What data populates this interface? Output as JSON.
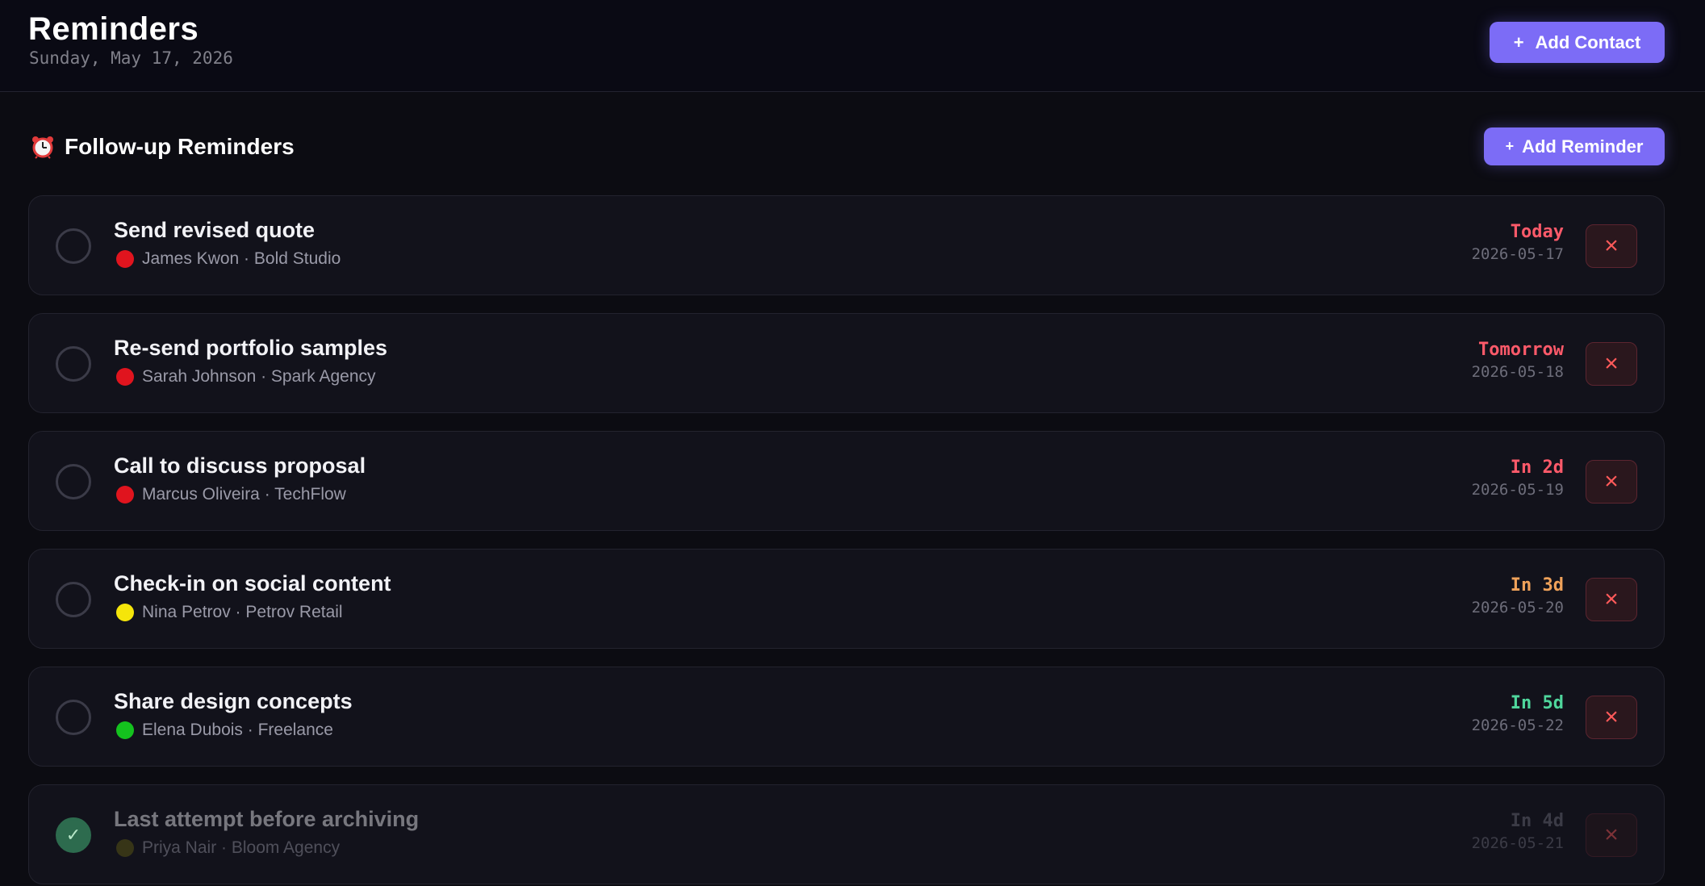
{
  "header": {
    "title": "Reminders",
    "date": "Sunday, May 17, 2026",
    "add_contact_label": "Add Contact",
    "add_contact_icon": "+"
  },
  "section": {
    "title": "Follow-up Reminders",
    "icon": "alarm-clock-icon",
    "add_reminder_label": "Add Reminder",
    "add_reminder_icon": "+"
  },
  "colors": {
    "accent": "#7c6cf6",
    "urgent": "#ff5a6a",
    "soon": "#f0a25a",
    "later": "#4fd69c"
  },
  "reminders": [
    {
      "title": "Send revised quote",
      "contact": "James Kwon · Bold Studio",
      "priority_color": "#e0141e",
      "due_label": "Today",
      "due_color": "#ff5a6a",
      "due_date": "2026-05-17",
      "done": false,
      "delete_icon": "×"
    },
    {
      "title": "Re-send portfolio samples",
      "contact": "Sarah Johnson · Spark Agency",
      "priority_color": "#e0141e",
      "due_label": "Tomorrow",
      "due_color": "#ff5a6a",
      "due_date": "2026-05-18",
      "done": false,
      "delete_icon": "×"
    },
    {
      "title": "Call to discuss proposal",
      "contact": "Marcus Oliveira · TechFlow",
      "priority_color": "#e0141e",
      "due_label": "In 2d",
      "due_color": "#ff5a6a",
      "due_date": "2026-05-19",
      "done": false,
      "delete_icon": "×"
    },
    {
      "title": "Check-in on social content",
      "contact": "Nina Petrov · Petrov Retail",
      "priority_color": "#f5e50a",
      "due_label": "In 3d",
      "due_color": "#f0a25a",
      "due_date": "2026-05-20",
      "done": false,
      "delete_icon": "×"
    },
    {
      "title": "Share design concepts",
      "contact": "Elena Dubois · Freelance",
      "priority_color": "#14c21e",
      "due_label": "In 5d",
      "due_color": "#4fd69c",
      "due_date": "2026-05-22",
      "done": false,
      "delete_icon": "×"
    },
    {
      "title": "Last attempt before archiving",
      "contact": "Priya Nair · Bloom Agency",
      "priority_color": "#c8c10a",
      "due_label": "In 4d",
      "due_color": "#8a8a96",
      "due_date": "2026-05-21",
      "done": true,
      "check_icon": "✓",
      "delete_icon": "×"
    }
  ]
}
